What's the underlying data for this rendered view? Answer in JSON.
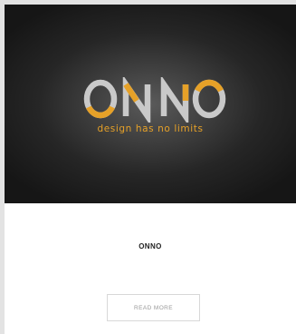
{
  "card": {
    "logo": {
      "wordmark": "ONNO",
      "tagline": "design has no limits",
      "colors": {
        "letters": "#c9c9c9",
        "accent": "#e6a128"
      }
    },
    "title": "ONNO",
    "read_more_label": "READ MORE"
  }
}
